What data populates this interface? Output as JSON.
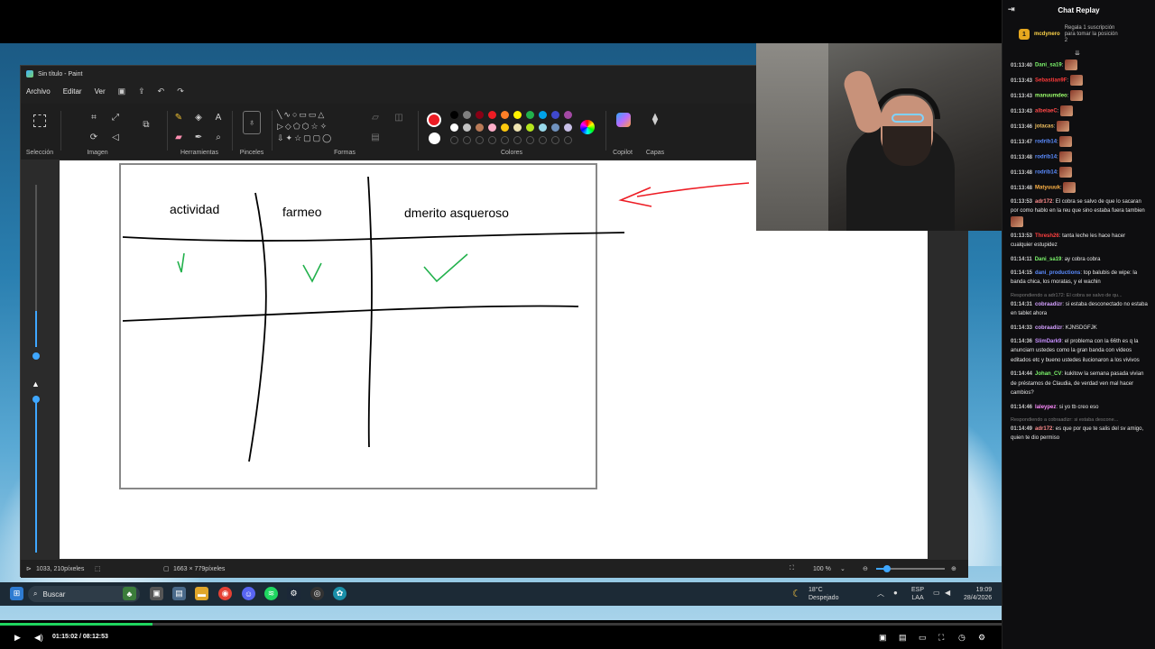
{
  "paint": {
    "title": "Sin título - Paint",
    "menu": [
      "Archivo",
      "Editar",
      "Ver"
    ],
    "groups": {
      "seleccion": "Selección",
      "imagen": "Imagen",
      "herramientas": "Herramientas",
      "pinceles": "Pinceles",
      "formas": "Formas",
      "colores": "Colores",
      "copilot": "Copilot",
      "capas": "Capas"
    },
    "colors": [
      "#000000",
      "#7f7f7f",
      "#880015",
      "#ed1c24",
      "#ff7f27",
      "#fff200",
      "#22b14c",
      "#00a2e8",
      "#3f48cc",
      "#a349a4",
      "#ffffff",
      "#c3c3c3",
      "#b97a57",
      "#ffaec9",
      "#ffc90e",
      "#efe4b0",
      "#b5e61d",
      "#99d9ea",
      "#7092be",
      "#c8bfe7"
    ],
    "primary_color": "#ed1c24",
    "secondary_color": "#ffffff",
    "drawing": {
      "headers": [
        "actividad",
        "farmeo",
        "dmerito asqueroso"
      ]
    },
    "status": {
      "cursor_pos": "1033, 210píxeles",
      "image_size": "1663 × 779píxeles",
      "zoom": "100 %"
    }
  },
  "taskbar": {
    "search_placeholder": "Buscar",
    "weather_temp": "18°C",
    "weather_desc": "Despejado",
    "lang": "ESP",
    "lang2": "LAA",
    "time": "19:09",
    "date": "28/4/2026"
  },
  "player": {
    "time": "01:15:02 / 08:12:53",
    "progress": 0.152
  },
  "chat": {
    "title": "Chat Replay",
    "pinned": {
      "badge": "1",
      "user": "mcdynero",
      "text": "Regala 1 suscripción para tomar la posición 2"
    },
    "messages": [
      {
        "ts": "01:13:40",
        "user": "Dani_sa19",
        "color": "#7cf56b",
        "text": "",
        "emote": true
      },
      {
        "ts": "01:13:43",
        "user": "Sebastian9F",
        "color": "#ff3a3a",
        "text": "",
        "emote": true
      },
      {
        "ts": "01:13:43",
        "user": "manuumdeo",
        "color": "#9bff6b",
        "text": "",
        "emote": true
      },
      {
        "ts": "01:13:43",
        "user": "albeiaeC",
        "color": "#ff4848",
        "text": "",
        "emote": true
      },
      {
        "ts": "01:13:46",
        "user": "jotacas",
        "color": "#f0c060",
        "text": "",
        "emote": true
      },
      {
        "ts": "01:13:47",
        "user": "rodrib14",
        "color": "#5b8cff",
        "text": "",
        "emote": true
      },
      {
        "ts": "01:13:48",
        "user": "rodrib14",
        "color": "#5b8cff",
        "text": "",
        "emote": true
      },
      {
        "ts": "01:13:48",
        "user": "rodrib14",
        "color": "#5b8cff",
        "text": "",
        "emote": true
      },
      {
        "ts": "01:13:48",
        "user": "Matyuuuk",
        "color": "#ffb347",
        "text": "",
        "emote": true
      },
      {
        "ts": "01:13:53",
        "user": "adr172",
        "color": "#ff8c8c",
        "text": "El cobra se salvo de que lo sacaran por como hablo en la reu que sino estaba fuera tambien",
        "emote": true
      },
      {
        "ts": "01:13:53",
        "user": "Thresh26",
        "color": "#ff4040",
        "text": "tanta leche les hace hacer cualquier estupidez",
        "emote": false
      },
      {
        "ts": "01:14:11",
        "user": "Dani_sa19",
        "color": "#7cf56b",
        "text": "ay cobra cobra",
        "emote": false
      },
      {
        "ts": "01:14:15",
        "user": "dani_productions",
        "color": "#5b8cff",
        "text": "top balubis de wipe: la banda chica, los moratas, y el wachin",
        "emote": false
      },
      {
        "reply": "Respondiendo a adr172: El cobra se salvo de qu..."
      },
      {
        "ts": "01:14:31",
        "user": "cobraadizr",
        "color": "#d4a0ff",
        "text": "si estaba desconectado no estaba en tablet ahora",
        "emote": false
      },
      {
        "ts": "01:14:33",
        "user": "cobraadizr",
        "color": "#d4a0ff",
        "text": "KJNSDGFJK",
        "emote": false
      },
      {
        "ts": "01:14:36",
        "user": "SlimDark9",
        "color": "#c890ff",
        "text": "el problema con la 66th es q la anunciarn ustedes como la gran banda con videos editados etc y bueno ustedes ilucionaron a los vivivos",
        "emote": false
      },
      {
        "ts": "01:14:44",
        "user": "Johan_CV",
        "color": "#7cf56b",
        "text": "kukitow la semana pasada vivian de préstamos de Claudia, de verdad ven mal hacer cambios?",
        "emote": false
      },
      {
        "ts": "01:14:46",
        "user": "laleypez",
        "color": "#ff8cff",
        "text": "si yo tb creo eso",
        "emote": false
      },
      {
        "reply": "Respondiendo a cobraadizr: si estaba descone..."
      },
      {
        "ts": "01:14:49",
        "user": "adr172",
        "color": "#ff8c8c",
        "text": "es que por que te salis del sv amigo, quien te dio permiso",
        "emote": false
      }
    ]
  }
}
